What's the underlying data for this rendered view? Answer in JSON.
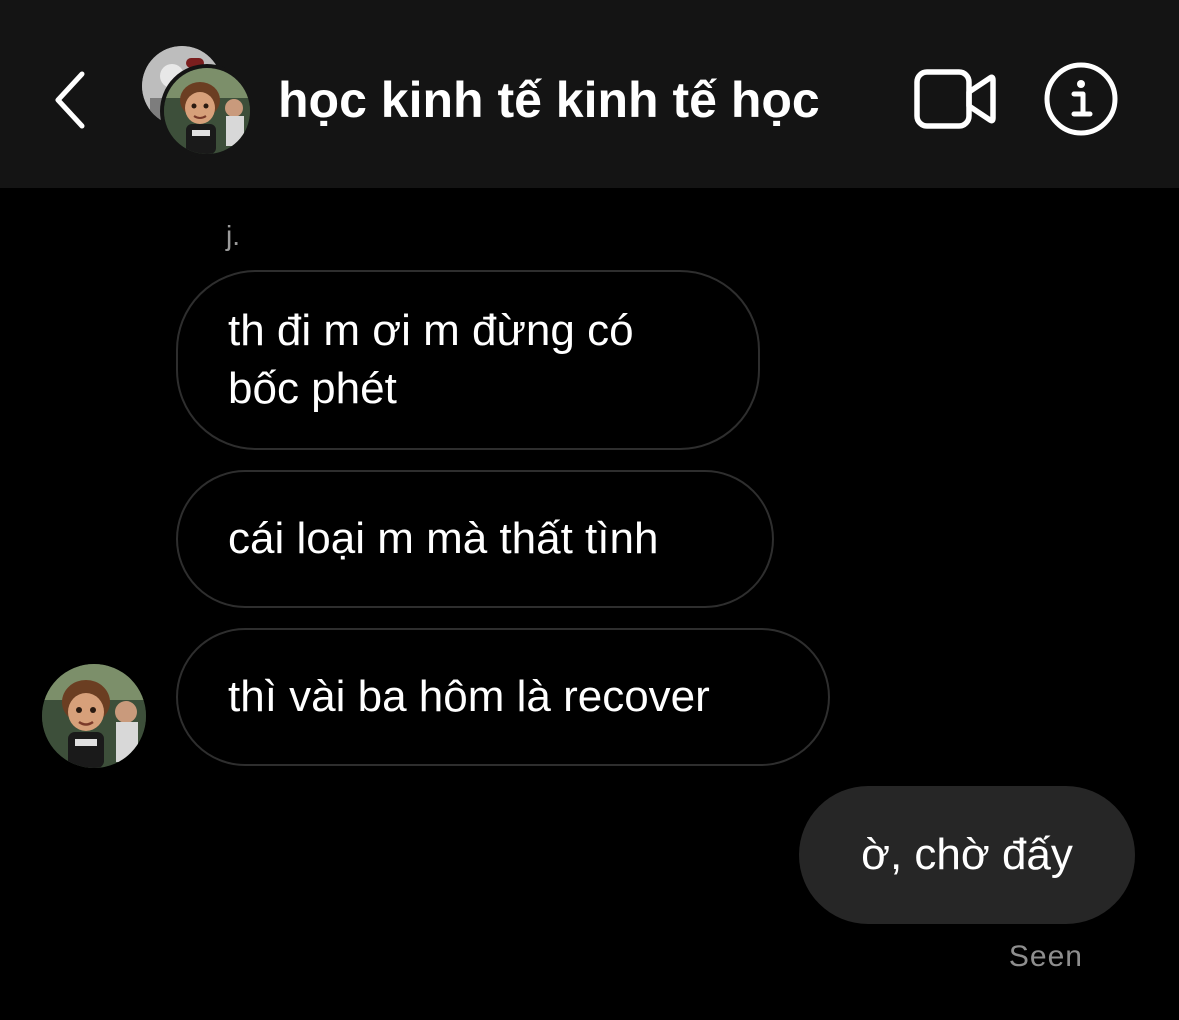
{
  "header": {
    "title": "học kinh tế kinh tế học",
    "back_icon": "chevron-left-icon",
    "video_icon": "video-camera-icon",
    "info_icon": "info-icon"
  },
  "messages": {
    "sender_name": "j.",
    "incoming": [
      "th đi m ơi m đừng có bốc phét",
      "cái loại m mà thất tình",
      "thì vài ba hôm là recover"
    ],
    "outgoing": [
      "ờ, chờ đấy"
    ],
    "status": "Seen"
  },
  "colors": {
    "background": "#000000",
    "header_background": "#141414",
    "incoming_border": "#2e2e2e",
    "outgoing_bubble": "#262626",
    "secondary_text": "#8e8e8e"
  }
}
